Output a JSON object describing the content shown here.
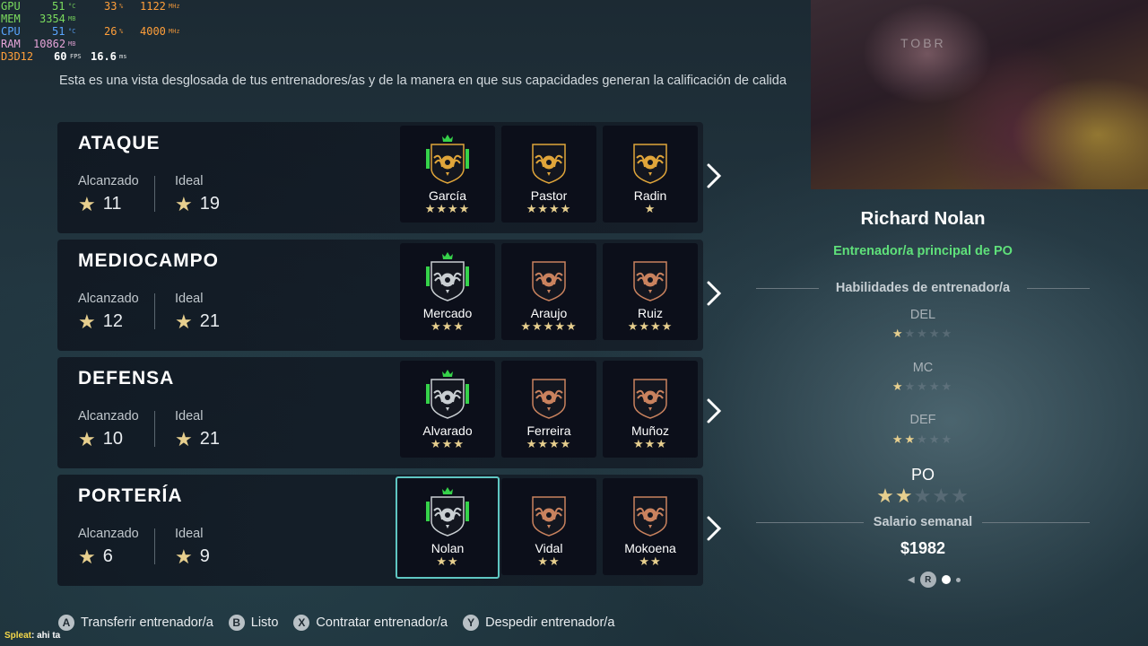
{
  "hud": {
    "gpu": {
      "label": "GPU",
      "temp": "51",
      "temp_unit": "°C",
      "load": "33",
      "load_unit": "%",
      "clock": "1122",
      "clock_unit": "MHz"
    },
    "mem": {
      "label": "MEM",
      "value": "3354",
      "unit": "MB"
    },
    "cpu": {
      "label": "CPU",
      "temp": "51",
      "temp_unit": "°C",
      "load": "26",
      "load_unit": "%",
      "clock": "4000",
      "clock_unit": "MHz"
    },
    "ram": {
      "label": "RAM",
      "value": "10862",
      "unit": "MB"
    },
    "d3d": {
      "label": "D3D12",
      "fps": "60",
      "fps_unit": "FPS",
      "frametime": "16.6",
      "frametime_unit": "ms"
    }
  },
  "intro_text": "Esta es una vista desglosada de tus entrenadores/as y de la manera en que sus capacidades generan la calificación de calida",
  "labels": {
    "reached": "Alcanzado",
    "ideal": "Ideal"
  },
  "sections": [
    {
      "title": "ATAQUE",
      "reached": "11",
      "ideal": "19",
      "coaches": [
        {
          "name": "García",
          "stars": "★★★★",
          "tier": "gold",
          "crown": true
        },
        {
          "name": "Pastor",
          "stars": "★★★★",
          "tier": "gold",
          "crown": false
        },
        {
          "name": "Radin",
          "stars": "★",
          "tier": "gold",
          "crown": false
        }
      ]
    },
    {
      "title": "MEDIOCAMPO",
      "reached": "12",
      "ideal": "21",
      "coaches": [
        {
          "name": "Mercado",
          "stars": "★★★",
          "tier": "silver",
          "crown": true
        },
        {
          "name": "Araujo",
          "stars": "★★★★★",
          "tier": "bronze",
          "crown": false
        },
        {
          "name": "Ruiz",
          "stars": "★★★★",
          "tier": "bronze",
          "crown": false
        }
      ]
    },
    {
      "title": "DEFENSA",
      "reached": "10",
      "ideal": "21",
      "coaches": [
        {
          "name": "Alvarado",
          "stars": "★★★",
          "tier": "silver",
          "crown": true
        },
        {
          "name": "Ferreira",
          "stars": "★★★★",
          "tier": "bronze",
          "crown": false
        },
        {
          "name": "Muñoz",
          "stars": "★★★",
          "tier": "bronze",
          "crown": false
        }
      ]
    },
    {
      "title": "PORTERÍA",
      "reached": "6",
      "ideal": "9",
      "coaches": [
        {
          "name": "Nolan",
          "stars": "★★",
          "tier": "silver",
          "crown": true,
          "selected": true
        },
        {
          "name": "Vidal",
          "stars": "★★",
          "tier": "bronze",
          "crown": false
        },
        {
          "name": "Mokoena",
          "stars": "★★",
          "tier": "bronze",
          "crown": false
        }
      ]
    }
  ],
  "detail": {
    "webcam_text": "TOBR",
    "coach_name": "Richard Nolan",
    "role": "Entrenador/a principal de PO",
    "skills_heading": "Habilidades de entrenador/a",
    "skills": [
      {
        "label": "DEL",
        "filled": 1,
        "total": 5
      },
      {
        "label": "MC",
        "filled": 1,
        "total": 5
      },
      {
        "label": "DEF",
        "filled": 2,
        "total": 5
      },
      {
        "label": "PO",
        "filled": 2,
        "total": 5,
        "highlight": true
      }
    ],
    "salary_label": "Salario semanal",
    "salary_value": "$1982",
    "pager_button": "R"
  },
  "footer": [
    {
      "icon": "A",
      "label": "Transferir entrenador/a"
    },
    {
      "icon": "B",
      "label": "Listo"
    },
    {
      "icon": "X",
      "label": "Contratar entrenador/a"
    },
    {
      "icon": "Y",
      "label": "Despedir entrenador/a"
    }
  ],
  "chat": {
    "user": "Spleat",
    "message": ": ahi ta"
  },
  "colors": {
    "gold": "#e0a53a",
    "silver": "#c9ced2",
    "bronze": "#c9825e",
    "crown": "#36d24a",
    "accent": "#5fc6c2",
    "role": "#5fe07a"
  }
}
